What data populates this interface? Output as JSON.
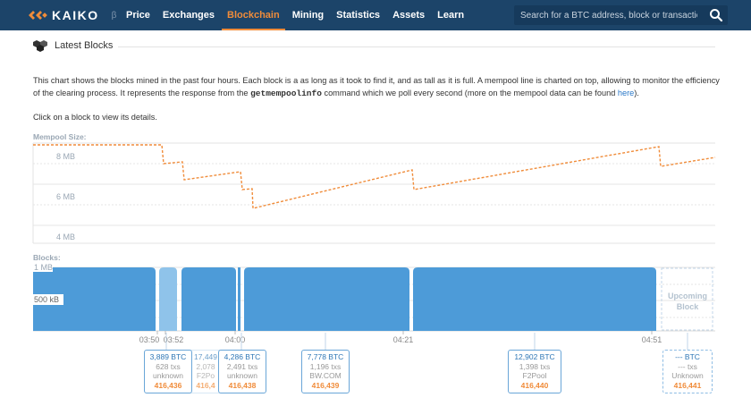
{
  "nav": {
    "logo_text": "KAIKO",
    "logo_beta": "β",
    "items": [
      {
        "label": "Price",
        "active": false
      },
      {
        "label": "Exchanges",
        "active": false
      },
      {
        "label": "Blockchain",
        "active": true
      },
      {
        "label": "Mining",
        "active": false
      },
      {
        "label": "Statistics",
        "active": false
      },
      {
        "label": "Assets",
        "active": false
      },
      {
        "label": "Learn",
        "active": false
      }
    ],
    "search_placeholder": "Search for a BTC address, block or transaction",
    "search_icon": "search-icon"
  },
  "section": {
    "title": "Latest Blocks",
    "icon": "blocks-icon"
  },
  "description": {
    "part1": "This chart shows the blocks mined in the past four hours. Each block is a as long as it took to find it, and as tall as it is full. A mempool line is charted on top, allowing to monitor the efficiency of the clearing process. It represents the response from the ",
    "code": "getmempoolinfo",
    "part2": " command which we poll every second (more on the mempool data can be found ",
    "link": "here",
    "part3": ")."
  },
  "click_hint": "Click on a block to view its details.",
  "mempool_label": "Mempool Size:",
  "blocks_label": "Blocks:",
  "mempool_ticks": [
    "8 MB",
    "6 MB",
    "4 MB"
  ],
  "blocks_ticks": [
    "1 MB",
    "500 kB"
  ],
  "time_labels": [
    "03:50",
    "03:52",
    "04:00",
    "04:21",
    "04:51"
  ],
  "upcoming_label_line1": "Upcoming",
  "upcoming_label_line2": "Block",
  "colors": {
    "nav_bg": "#1c4469",
    "accent": "#f08c3a",
    "block_fill": "#4d9bd8",
    "block_light": "#8fc3ea",
    "link": "#2a78c8"
  },
  "block_cards": [
    {
      "btc": "3,889 BTC",
      "txs": "628 txs",
      "pool": "unknown",
      "height": "416,436",
      "style": "normal"
    },
    {
      "btc": "17,449",
      "txs": "2,078",
      "pool": "F2Po",
      "height": "416,4",
      "style": "ghost"
    },
    {
      "btc": "4,286 BTC",
      "txs": "2,491 txs",
      "pool": "unknown",
      "height": "416,438",
      "style": "normal"
    },
    {
      "btc": "7,778 BTC",
      "txs": "1,196 txs",
      "pool": "BW.COM",
      "height": "416,439",
      "style": "normal"
    },
    {
      "btc": "12,902 BTC",
      "txs": "1,398 txs",
      "pool": "F2Pool",
      "height": "416,440",
      "style": "normal"
    },
    {
      "btc": "--- BTC",
      "txs": "--- txs",
      "pool": "Unknown",
      "height": "416,441",
      "style": "upcoming"
    }
  ]
}
